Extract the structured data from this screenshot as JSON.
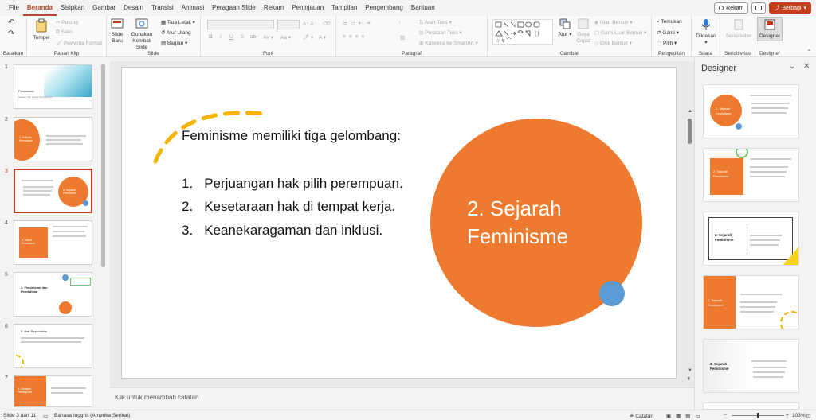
{
  "menu": {
    "tabs": [
      "File",
      "Beranda",
      "Sisipkan",
      "Gambar",
      "Desain",
      "Transisi",
      "Animasi",
      "Peragaan Slide",
      "Rekam",
      "Peninjauan",
      "Tampilan",
      "Pengembang",
      "Bantuan"
    ],
    "active": "Beranda"
  },
  "topright": {
    "record": "Rekam",
    "share": "Berbagi"
  },
  "ribbon": {
    "groups": {
      "undo": "Batalkan",
      "clipboard": "Papan Klip",
      "slides": "Slide",
      "font": "Font",
      "paragraph": "Paragraf",
      "drawing": "Gambar",
      "editing": "Pengeditan",
      "voice": "Suara",
      "sensitivity": "Sensitivitas",
      "designer": "Designer"
    },
    "clipboard": {
      "paste": "Tempel",
      "cut": "Potong",
      "copy": "Salin",
      "format_painter": "Pewarna Format"
    },
    "slides": {
      "new_slide_1": "Slide",
      "new_slide_2": "Baru",
      "reuse_1": "Gunakan",
      "reuse_2": "Kembali Slide",
      "layout": "Tata Letak",
      "reset": "Atur Ulang",
      "section": "Bagian"
    },
    "paragraph": {
      "text_direction": "Arah Teks",
      "align_text": "Perataan Teks",
      "smartart": "Konversi ke SmartArt"
    },
    "drawing": {
      "arrange": "Atur",
      "quick_styles_1": "Gaya",
      "quick_styles_2": "Cepat",
      "shape_fill": "Isian Bentuk",
      "shape_outline": "Garis Luar Bentuk",
      "shape_effects": "Efek Bentuk"
    },
    "editing": {
      "find": "Temukan",
      "replace": "Ganti",
      "select": "Pilih"
    },
    "voice": {
      "dictate": "Diktekan"
    },
    "sensitivity": {
      "label": "Sensitivitas"
    },
    "designer": {
      "label": "Designer"
    }
  },
  "thumbnails": [
    {
      "num": "1",
      "title": "Feminisme",
      "sub": "Sejarah dan perkembangannya"
    },
    {
      "num": "2",
      "title": "1. Definisi Feminisme"
    },
    {
      "num": "3",
      "title": "2. Sejarah Feminisme"
    },
    {
      "num": "4",
      "title": "3. Tokoh Feminisme"
    },
    {
      "num": "5",
      "title": "4. Feminisme dan Pendidikan"
    },
    {
      "num": "6",
      "title": "5. Hak Reproduksi"
    },
    {
      "num": "7",
      "title": "6. Gerakan Perempuan"
    }
  ],
  "slide": {
    "intro": "Feminisme memiliki tiga gelombang:",
    "items": [
      {
        "num": "1.",
        "text": "Perjuangan hak pilih perempuan."
      },
      {
        "num": "2.",
        "text": "Kesetaraan hak di tempat kerja."
      },
      {
        "num": "3.",
        "text": "Keanekaragaman dan inklusi."
      }
    ],
    "circle_line1": "2. Sejarah",
    "circle_line2": "Feminisme",
    "colors": {
      "accent": "#ee7a2f",
      "blue": "#5b9bd5",
      "yellow": "#f4b400"
    }
  },
  "notes": {
    "placeholder": "Klik untuk menambah catatan"
  },
  "designer": {
    "title": "Designer",
    "card_title_a": "2. Sejarah",
    "card_title_b": "Feminisme"
  },
  "status": {
    "slide_info": "Slide 3 dari 11",
    "language": "Bahasa Inggris (Amerika Serikat)",
    "notes": "Catatan",
    "zoom": "103%"
  }
}
